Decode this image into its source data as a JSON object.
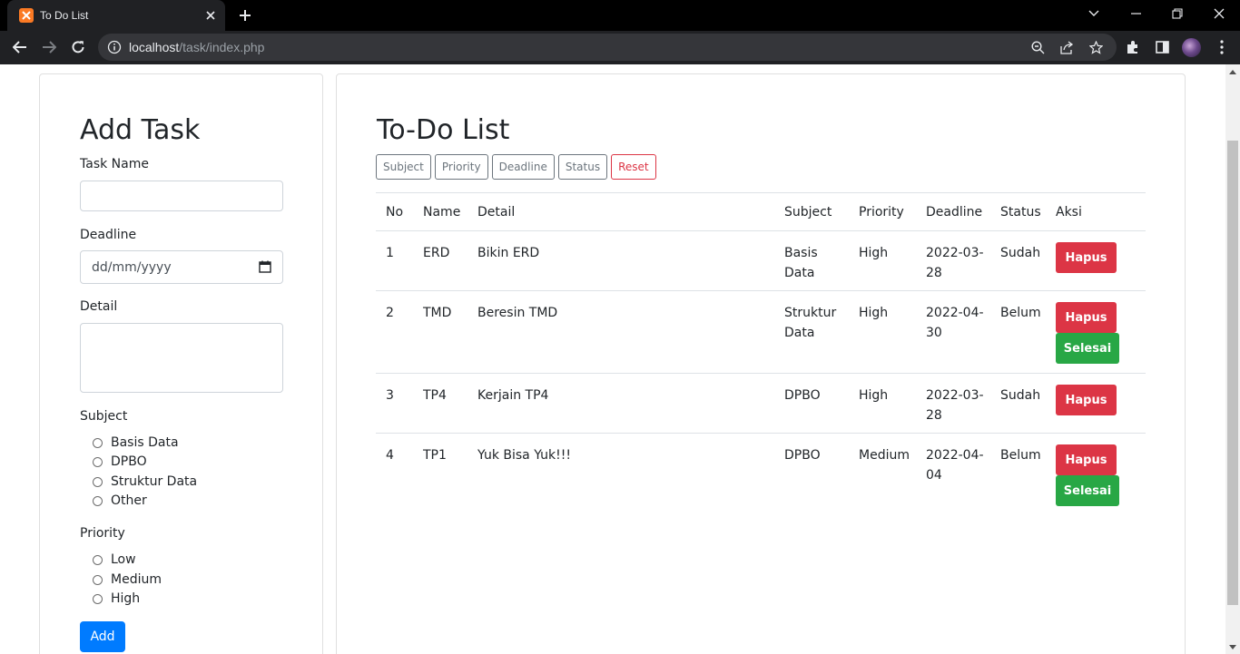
{
  "browser": {
    "tab_title": "To Do List",
    "url_host": "localhost",
    "url_path": "/task/index.php"
  },
  "add_form": {
    "heading": "Add Task",
    "task_name_label": "Task Name",
    "task_name_value": "",
    "deadline_label": "Deadline",
    "deadline_placeholder": "dd/mm/yyyy",
    "detail_label": "Detail",
    "detail_value": "",
    "subject_label": "Subject",
    "subject_options": [
      "Basis Data",
      "DPBO",
      "Struktur Data",
      "Other"
    ],
    "priority_label": "Priority",
    "priority_options": [
      "Low",
      "Medium",
      "High"
    ],
    "submit_label": "Add"
  },
  "todo": {
    "heading": "To-Do List",
    "filters": [
      "Subject",
      "Priority",
      "Deadline",
      "Status",
      "Reset"
    ],
    "columns": [
      "No",
      "Name",
      "Detail",
      "Subject",
      "Priority",
      "Deadline",
      "Status",
      "Aksi"
    ],
    "rows": [
      {
        "no": "1",
        "name": "ERD",
        "detail": "Bikin ERD",
        "subject": [
          "Basis",
          "Data"
        ],
        "priority": "High",
        "deadline": [
          "2022-03-",
          "28"
        ],
        "status": "Sudah",
        "actions": [
          "Hapus"
        ]
      },
      {
        "no": "2",
        "name": "TMD",
        "detail": "Beresin TMD",
        "subject": [
          "Struktur",
          "Data"
        ],
        "priority": "High",
        "deadline": [
          "2022-04-",
          "30"
        ],
        "status": "Belum",
        "actions": [
          "Hapus",
          "Selesai"
        ]
      },
      {
        "no": "3",
        "name": "TP4",
        "detail": "Kerjain TP4",
        "subject": [
          "DPBO"
        ],
        "priority": "High",
        "deadline": [
          "2022-03-",
          "28"
        ],
        "status": "Sudah",
        "actions": [
          "Hapus"
        ]
      },
      {
        "no": "4",
        "name": "TP1",
        "detail": "Yuk Bisa Yuk!!!",
        "subject": [
          "DPBO"
        ],
        "priority": "Medium",
        "deadline": [
          "2022-04-",
          "04"
        ],
        "status": "Belum",
        "actions": [
          "Hapus",
          "Selesai"
        ]
      }
    ]
  },
  "colors": {
    "danger": "#dc3545",
    "success": "#28a745",
    "primary": "#007bff",
    "secondary": "#6c757d"
  }
}
